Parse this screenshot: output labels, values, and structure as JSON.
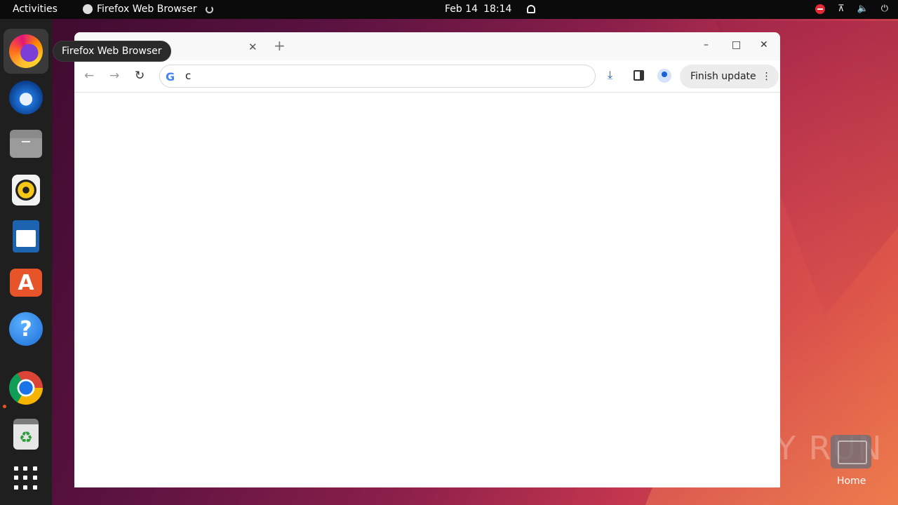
{
  "topbar": {
    "activities": "Activities",
    "app_name": "Firefox Web Browser",
    "date": "Feb 14",
    "time": "18:14"
  },
  "tooltip": "Firefox Web Browser",
  "dock": {
    "items": [
      "firefox",
      "thunderbird",
      "files",
      "rhythmbox",
      "libreoffice-writer",
      "app-center",
      "help",
      "chrome",
      "trash"
    ]
  },
  "browser": {
    "omnibox_value": "c",
    "finish_update": "Finish update",
    "controls": {
      "minimize": "–",
      "maximize": "□",
      "close": "✕"
    }
  },
  "desktop": {
    "home_label": "Home",
    "watermark": "ANY RUN"
  },
  "colors": {
    "accent": "#e95420",
    "chrome_blue": "#1a73e8"
  }
}
